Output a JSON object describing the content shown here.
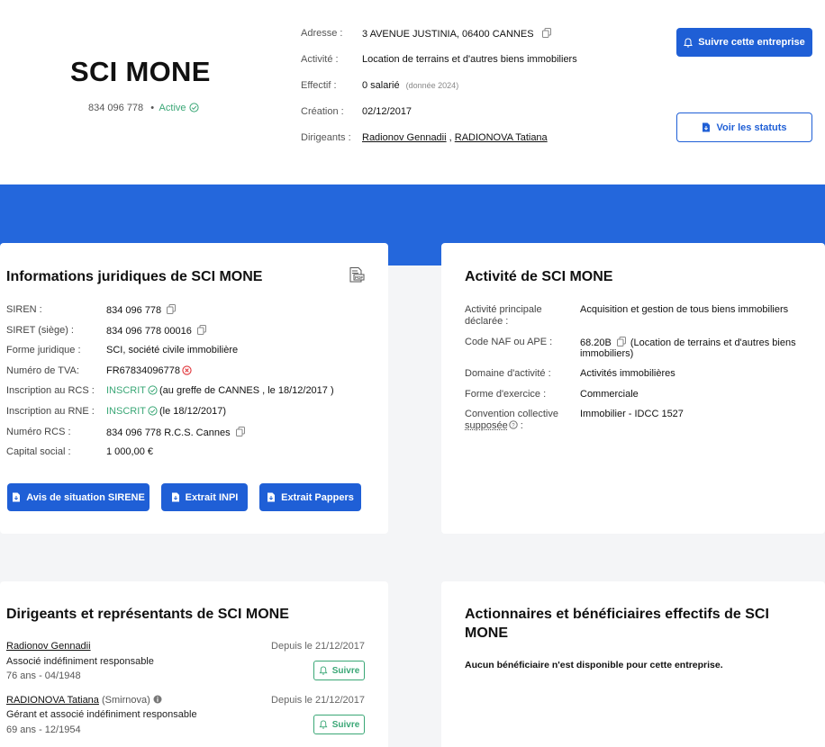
{
  "company": {
    "name": "SCI MONE",
    "siren_short": "834 096 778",
    "status": "Active"
  },
  "header_info": [
    {
      "label": "Adresse :",
      "value": "3 AVENUE JUSTINIA, 06400 CANNES"
    },
    {
      "label": "Activité :",
      "value": "Location de terrains et d'autres biens immobiliers"
    },
    {
      "label": "Effectif :",
      "value": "0 salarié",
      "note": "(donnée 2024)"
    },
    {
      "label": "Création :",
      "value": "02/12/2017"
    },
    {
      "label": "Dirigeants :",
      "value_1": "Radionov Gennadii",
      "sep": " , ",
      "value_2": "RADIONOVA Tatiana"
    }
  ],
  "header_buttons": {
    "follow": "Suivre cette entreprise",
    "statuts": "Voir les statuts"
  },
  "legal": {
    "title": "Informations juridiques de SCI MONE",
    "rows": [
      {
        "label": "SIREN :",
        "value": "834 096 778"
      },
      {
        "label": "SIRET (siège) :",
        "value": "834 096 778 00016"
      },
      {
        "label": "Forme juridique :",
        "value": "SCI, société civile immobilière"
      },
      {
        "label": "Numéro de TVA:",
        "value": "FR67834096778"
      },
      {
        "label": "Inscription au RCS :",
        "status": "INSCRIT",
        "value": "(au greffe de CANNES , le 18/12/2017 )"
      },
      {
        "label": "Inscription au RNE :",
        "status": "INSCRIT",
        "value": "(le 18/12/2017)"
      },
      {
        "label": "Numéro RCS :",
        "value": "834 096 778 R.C.S. Cannes"
      },
      {
        "label": "Capital social :",
        "value": "1 000,00 €"
      }
    ],
    "buttons": [
      "Avis de situation SIRENE",
      "Extrait INPI",
      "Extrait Pappers"
    ]
  },
  "activity": {
    "title": "Activité de SCI MONE",
    "rows": [
      {
        "label_1": "Activité principale",
        "label_2": "déclarée :",
        "value": "Acquisition et gestion de tous biens immobiliers"
      },
      {
        "label": "Code NAF ou APE :",
        "code": "68.20B",
        "value_1": "(Location de terrains et d'autres biens",
        "value_2": "immobiliers)"
      },
      {
        "label": "Domaine d'activité :",
        "value": "Activités immobilières"
      },
      {
        "label": "Forme d'exercice :",
        "value": "Commerciale"
      },
      {
        "label_1": "Convention collective",
        "label_2": "supposée",
        "label_3": ":",
        "value": "Immobilier - IDCC 1527"
      }
    ]
  },
  "directors": {
    "title": "Dirigeants et représentants de SCI MONE",
    "follow_label": "Suivre",
    "items": [
      {
        "name": "Radionov Gennadii",
        "role": "Associé indéfiniment responsable",
        "age": "76 ans - 04/1948",
        "since": "Depuis le 21/12/2017"
      },
      {
        "name": "RADIONOVA Tatiana",
        "alias": "(Smirnova)",
        "role": "Gérant et associé indéfiniment responsable",
        "age": "69 ans - 12/1954",
        "since": "Depuis le 21/12/2017"
      }
    ]
  },
  "shareholders": {
    "title_1": "Actionnaires et bénéficiaires effectifs de SCI",
    "title_2": "MONE",
    "message": "Aucun bénéficiaire n'est disponible pour cette entreprise."
  },
  "colors": {
    "primary": "#1f5fd6",
    "band": "#2467dc",
    "success": "#3aa776",
    "danger": "#e0343a"
  }
}
